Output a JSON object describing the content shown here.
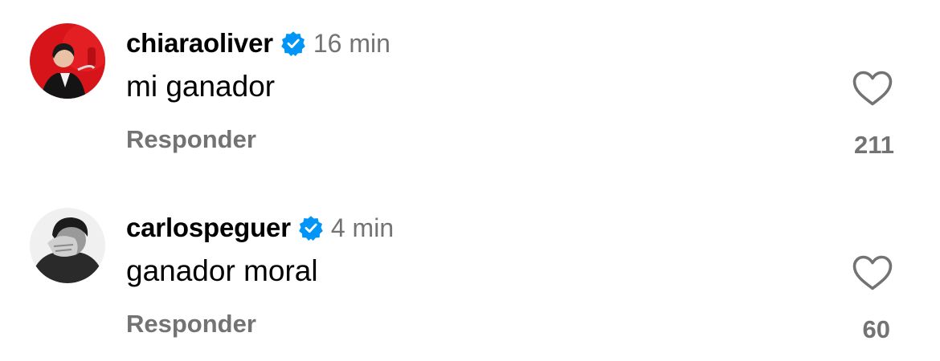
{
  "comments": [
    {
      "username": "chiaraoliver",
      "verified": true,
      "time": "16 min",
      "text": "mi ganador",
      "reply_label": "Responder",
      "likes": "211",
      "avatar": "avatar-chiaraoliver-red-background"
    },
    {
      "username": "carlospeguer",
      "verified": true,
      "time": "4 min",
      "text": "ganador moral",
      "reply_label": "Responder",
      "likes": "60",
      "avatar": "avatar-carlospeguer-grayscale"
    }
  ],
  "colors": {
    "verified_badge": "#0095F6",
    "secondary_text": "#737373",
    "primary_text": "#000000"
  },
  "icons": {
    "verified": "verified-badge-icon",
    "like": "heart-outline-icon"
  }
}
